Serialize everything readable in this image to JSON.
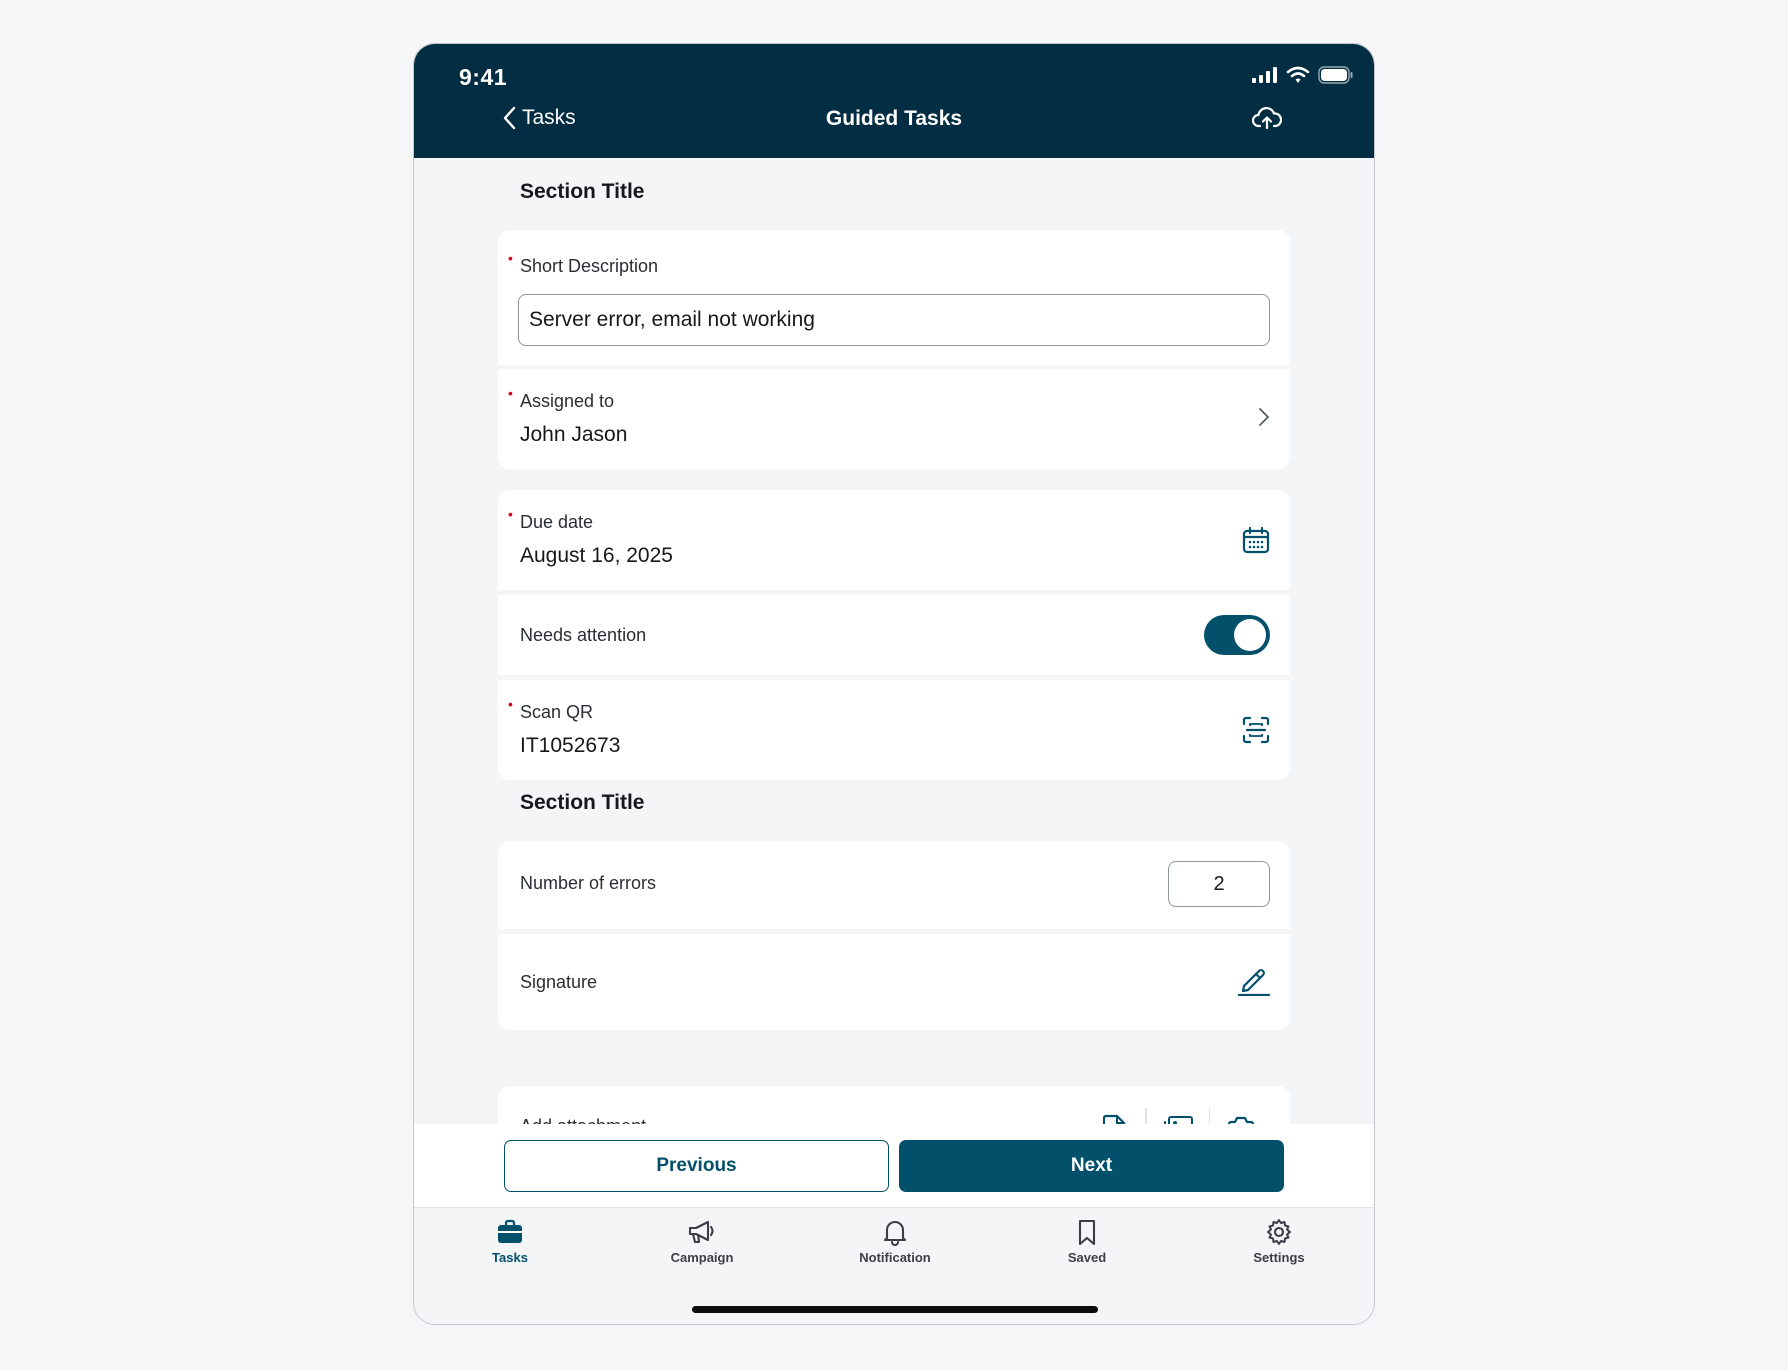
{
  "status_bar": {
    "time": "9:41"
  },
  "nav": {
    "back_label": "Tasks",
    "title": "Guided Tasks"
  },
  "sections": [
    {
      "title": "Section Title"
    },
    {
      "title": "Section Title"
    }
  ],
  "fields": {
    "short_description": {
      "label": "Short Description",
      "value": "Server error, email not working",
      "required": true
    },
    "assigned_to": {
      "label": "Assigned to",
      "value": "John Jason",
      "required": true
    },
    "due_date": {
      "label": "Due date",
      "value": "August 16, 2025",
      "required": true
    },
    "needs_attention": {
      "label": "Needs attention",
      "on": true
    },
    "scan_qr": {
      "label": "Scan QR",
      "value": "IT1052673",
      "required": true
    },
    "number_of_errors": {
      "label": "Number of errors",
      "value": "2"
    },
    "signature": {
      "label": "Signature"
    },
    "add_attachment": {
      "label": "Add attachment"
    }
  },
  "actions": {
    "previous": "Previous",
    "next": "Next"
  },
  "tabs": [
    {
      "label": "Tasks",
      "icon": "briefcase-icon",
      "active": true
    },
    {
      "label": "Campaign",
      "icon": "megaphone-icon",
      "active": false
    },
    {
      "label": "Notification",
      "icon": "bell-icon",
      "active": false
    },
    {
      "label": "Saved",
      "icon": "bookmark-icon",
      "active": false
    },
    {
      "label": "Settings",
      "icon": "gear-icon",
      "active": false
    }
  ],
  "colors": {
    "header_bg": "#032d42",
    "primary": "#02506a",
    "required_marker": "#d0021b",
    "page_bg": "#f4f5f7"
  }
}
